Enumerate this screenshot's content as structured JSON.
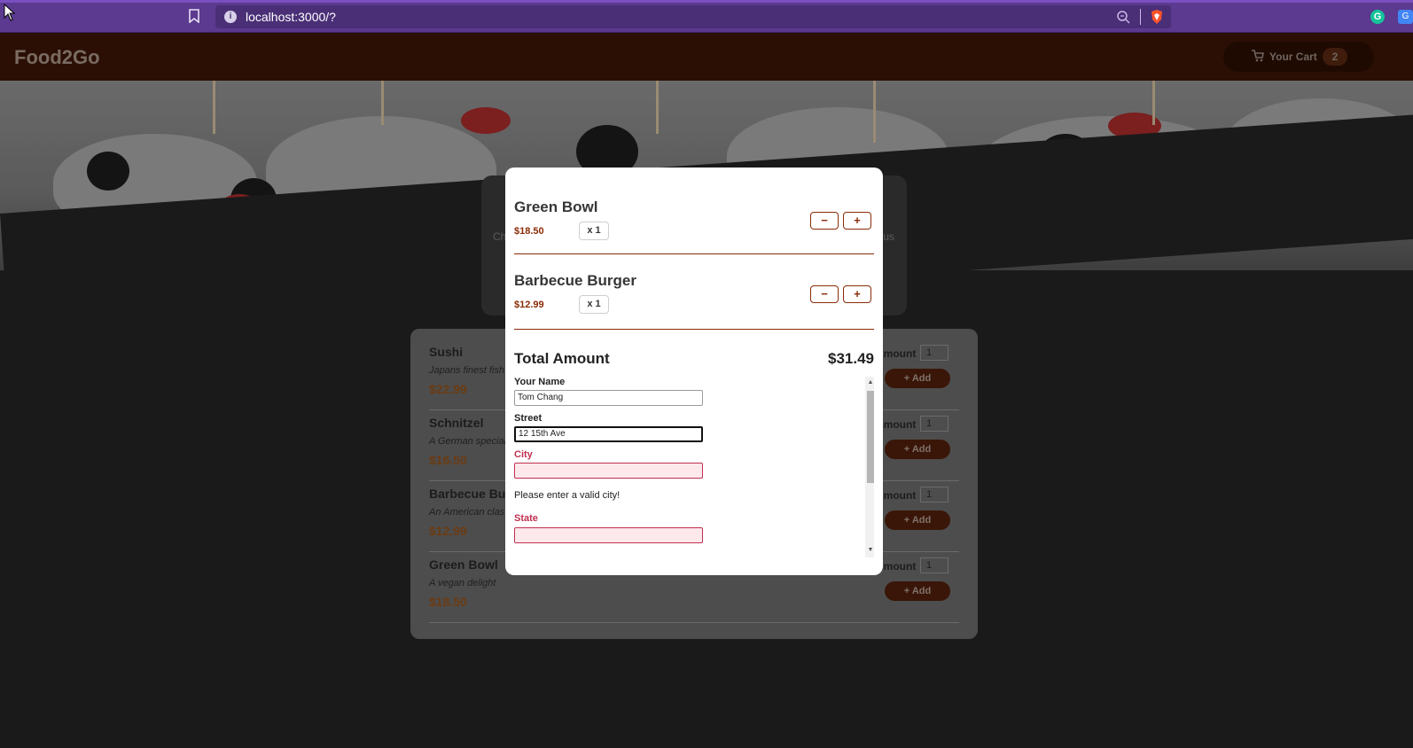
{
  "browser": {
    "url": "localhost:3000/?",
    "info_icon": "i",
    "grammarly_icon": "G",
    "translate_icon": "G"
  },
  "app": {
    "logo": "Food2Go",
    "cart_label": "Your Cart",
    "cart_count": "2"
  },
  "summary": {
    "left_fragment": "Ch",
    "right_fragment": "ous"
  },
  "meals": [
    {
      "name": "Sushi",
      "description": "Japans finest fish",
      "price": "$22.99",
      "amount_label": "Amount",
      "amount": "1",
      "add_label": "+ Add"
    },
    {
      "name": "Schnitzel",
      "description": "A German special",
      "price": "$16.50",
      "amount_label": "Amount",
      "amount": "1",
      "add_label": "+ Add"
    },
    {
      "name": "Barbecue Bur",
      "description": "An American clas",
      "price": "$12.99",
      "amount_label": "Amount",
      "amount": "1",
      "add_label": "+ Add"
    },
    {
      "name": "Green Bowl",
      "description": "A vegan delight",
      "price": "$18.50",
      "amount_label": "Amount",
      "amount": "1",
      "add_label": "+ Add"
    }
  ],
  "modal": {
    "items": [
      {
        "name": "Green Bowl",
        "price": "$18.50",
        "qty": "x 1",
        "minus": "−",
        "plus": "+"
      },
      {
        "name": "Barbecue Burger",
        "price": "$12.99",
        "qty": "x 1",
        "minus": "−",
        "plus": "+"
      }
    ],
    "total_label": "Total Amount",
    "total_value": "$31.49",
    "form": {
      "name_label": "Your Name",
      "name_value": "Tom Chang",
      "street_label": "Street",
      "street_value": "12 15th Ave",
      "city_label": "City",
      "city_value": "",
      "city_error": "Please enter a valid city!",
      "state_label": "State",
      "state_value": ""
    },
    "scroll_up": "▲",
    "scroll_down": "▼"
  }
}
